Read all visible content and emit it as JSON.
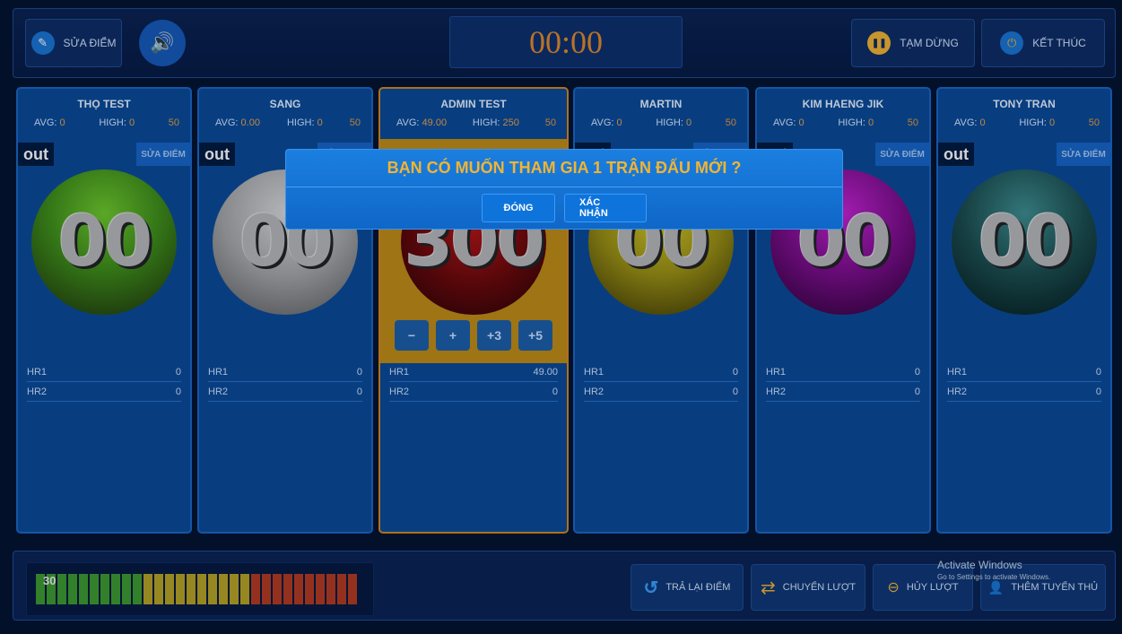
{
  "topbar": {
    "edit_score_label": "SỬA ĐIỂM",
    "timer": "00:00",
    "pause_label": "TẠM DỪNG",
    "end_label": "KẾT THÚC"
  },
  "labels": {
    "avg": "AVG:",
    "high": "HIGH:",
    "out": "out",
    "edit_score": "SỬA ĐIỂM",
    "hr1": "HR1",
    "hr2": "HR2"
  },
  "players": [
    {
      "name": "THỌ TEST",
      "avg": "0",
      "high": "0",
      "limit": "50",
      "score": "00",
      "hr1": "0",
      "hr2": "0",
      "ball_color": "green"
    },
    {
      "name": "SANG",
      "avg": "0.00",
      "high": "0",
      "limit": "50",
      "score": "00",
      "hr1": "0",
      "hr2": "0",
      "ball_color": "silver"
    },
    {
      "name": "ADMIN TEST",
      "avg": "49.00",
      "high": "250",
      "limit": "50",
      "score": "300",
      "hr1": "49.00",
      "hr2": "0",
      "ball_color": "dark-red",
      "active": true
    },
    {
      "name": "MARTIN",
      "avg": "0",
      "high": "0",
      "limit": "50",
      "score": "00",
      "hr1": "0",
      "hr2": "0",
      "ball_color": "olive"
    },
    {
      "name": "KIM HAENG JIK",
      "avg": "0",
      "high": "0",
      "limit": "50",
      "score": "00",
      "hr1": "0",
      "hr2": "0",
      "ball_color": "purple"
    },
    {
      "name": "TONY TRAN",
      "avg": "0",
      "high": "0",
      "limit": "50",
      "score": "00",
      "hr1": "0",
      "hr2": "0",
      "ball_color": "teal"
    }
  ],
  "controls": {
    "minus": "−",
    "plus": "+",
    "plus3": "+3",
    "plus5": "+5"
  },
  "modal": {
    "title": "BẠN CÓ MUỐN THAM GIA 1 TRẬN ĐẤU MỚI ?",
    "close_label": "ĐÓNG",
    "confirm_label": "XÁC NHẬN"
  },
  "bottombar": {
    "meter_value": "30",
    "return_score_label": "TRẢ LẠI ĐIỂM",
    "switch_turn_label": "CHUYỂN LƯỢT",
    "cancel_turn_label": "HỦY LƯỢT",
    "add_player_label": "THÊM TUYỂN THỦ"
  },
  "watermark": {
    "title": "Activate Windows",
    "subtitle": "Go to Settings to activate Windows."
  },
  "colors": {
    "accent": "#f3b431",
    "timer": "#e18a2b",
    "active_border": "#d4881e"
  }
}
